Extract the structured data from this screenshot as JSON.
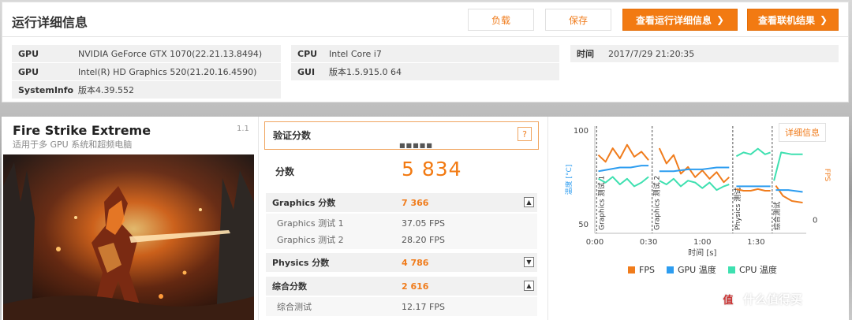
{
  "header": {
    "title": "运行详细信息",
    "load_label": "负载",
    "save_label": "保存",
    "details_label": "查看运行详细信息",
    "online_label": "查看联机结果"
  },
  "system_info": {
    "gpu1_key": "GPU",
    "gpu1_val": "NVIDIA GeForce GTX 1070(22.21.13.8494)",
    "gpu2_key": "GPU",
    "gpu2_val": "Intel(R) HD Graphics 520(21.20.16.4590)",
    "sysinfo_key": "SystemInfo",
    "sysinfo_val": "版本4.39.552",
    "cpu_key": "CPU",
    "cpu_val": "Intel Core i7",
    "gui_key": "GUI",
    "gui_val": "版本1.5.915.0 64",
    "time_key": "时间",
    "time_val": "2017/7/29 21:20:35"
  },
  "benchmark": {
    "name": "Fire Strike Extreme",
    "subtitle": "适用于多 GPU 系统和超频电脑",
    "version": "1.1"
  },
  "verify": {
    "label": "验证分数",
    "help": "?",
    "dots": "■■■■■"
  },
  "score": {
    "label": "分数",
    "value": "5 834"
  },
  "rows": {
    "graphics": {
      "label": "Graphics 分数",
      "value": "7 366",
      "toggle": "▲"
    },
    "gt1": {
      "label": "Graphics 测试 1",
      "value": "37.05 FPS"
    },
    "gt2": {
      "label": "Graphics 测试 2",
      "value": "28.20 FPS"
    },
    "physics": {
      "label": "Physics 分数",
      "value": "4 786",
      "toggle": "▼"
    },
    "combined": {
      "label": "综合分数",
      "value": "2 616",
      "toggle": "▲"
    },
    "ct": {
      "label": "综合测试",
      "value": "12.17 FPS"
    }
  },
  "details_button": "详细信息",
  "colors": {
    "accent": "#f27a12",
    "fps": "#f07c1c",
    "gpu_temp": "#2d9df0",
    "cpu_temp": "#3ee0b0"
  },
  "chart_data": {
    "type": "line",
    "x_label": "时间 [s]",
    "x_ticks": [
      "0:00",
      "0:30",
      "1:00",
      "1:30"
    ],
    "x_tick_seconds": [
      0,
      30,
      60,
      90
    ],
    "xlim": [
      0,
      118
    ],
    "left_axis": {
      "label": "温度 [°C]",
      "ticks": [
        "100",
        "50"
      ],
      "tick_values": [
        100,
        50
      ],
      "ylim": [
        45,
        102
      ]
    },
    "right_axis": {
      "label": "FPS",
      "ticks": [
        "50",
        "0"
      ],
      "tick_values": [
        50,
        0
      ],
      "ylim": [
        -8,
        55
      ]
    },
    "sections": [
      {
        "label": "Graphics 测试 1",
        "start": 1
      },
      {
        "label": "Graphics 测试 2",
        "start": 32
      },
      {
        "label": "Physics 测试",
        "start": 77
      },
      {
        "label": "综合测试",
        "start": 99
      }
    ],
    "series": [
      {
        "name": "FPS",
        "axis": "right",
        "color": "#f07c1c",
        "x": [
          2,
          6,
          10,
          14,
          18,
          22,
          26,
          30,
          null,
          36,
          40,
          44,
          48,
          52,
          56,
          60,
          64,
          68,
          72,
          75,
          null,
          79,
          83,
          87,
          91,
          95,
          98,
          null,
          101,
          105,
          110,
          116
        ],
        "y": [
          38,
          34,
          42,
          36,
          44,
          37,
          40,
          35,
          null,
          42,
          33,
          38,
          27,
          31,
          25,
          29,
          24,
          28,
          22,
          25,
          null,
          18,
          17,
          17,
          18,
          17,
          17,
          null,
          20,
          14,
          11,
          10
        ]
      },
      {
        "name": "GPU 温度",
        "axis": "left",
        "color": "#2d9df0",
        "x": [
          2,
          8,
          14,
          20,
          26,
          30,
          null,
          36,
          44,
          52,
          60,
          68,
          75,
          null,
          79,
          87,
          95,
          98,
          null,
          101,
          108,
          116
        ],
        "y": [
          78,
          79,
          80,
          80,
          81,
          81,
          null,
          78,
          78,
          79,
          79,
          80,
          80,
          null,
          70,
          70,
          70,
          70,
          null,
          68,
          68,
          67
        ]
      },
      {
        "name": "CPU 温度",
        "axis": "left",
        "color": "#3ee0b0",
        "x": [
          2,
          6,
          10,
          14,
          18,
          22,
          26,
          30,
          null,
          36,
          40,
          44,
          48,
          52,
          56,
          60,
          64,
          68,
          72,
          75,
          null,
          79,
          83,
          87,
          91,
          95,
          98,
          null,
          100,
          104,
          110,
          116
        ],
        "y": [
          74,
          72,
          75,
          71,
          74,
          70,
          72,
          75,
          null,
          73,
          71,
          74,
          70,
          73,
          72,
          69,
          72,
          68,
          70,
          71,
          null,
          86,
          88,
          87,
          90,
          87,
          88,
          null,
          73,
          88,
          87,
          87
        ]
      }
    ]
  }
}
